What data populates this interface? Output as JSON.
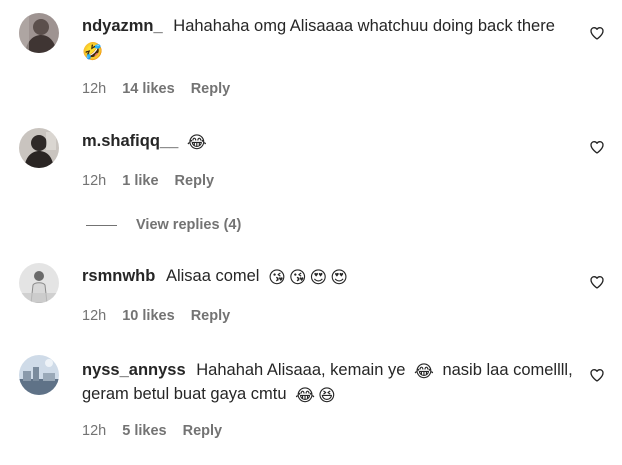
{
  "comments": [
    {
      "username": "ndyazmn_",
      "text": "Hahahaha omg Alisaaaa whatchuu doing back there",
      "emojis": [
        "🤣"
      ],
      "time": "12h",
      "likes": "14 likes",
      "reply": "Reply",
      "heart_icon": "heart-outline-icon"
    },
    {
      "username": "m.shafiqq__",
      "text": "",
      "emojis": [
        "😂"
      ],
      "time": "12h",
      "likes": "1 like",
      "reply": "Reply",
      "heart_icon": "heart-outline-icon"
    },
    {
      "username": "rsmnwhb",
      "text": "Alisaa comel",
      "emojis": [
        "😘",
        "😘",
        "😍",
        "😍"
      ],
      "time": "12h",
      "likes": "10 likes",
      "reply": "Reply",
      "heart_icon": "heart-outline-icon"
    },
    {
      "username": "nyss_annyss",
      "text_part1": "Hahahah Alisaaa, kemain ye",
      "text_part2": "nasib laa comellll,",
      "text_part3": "geram betul buat gaya cmtu",
      "emojis_mid": [
        "😂"
      ],
      "emojis_end": [
        "😂",
        "😆"
      ],
      "time": "12h",
      "likes": "5 likes",
      "reply": "Reply",
      "heart_icon": "heart-outline-icon"
    }
  ],
  "view_replies": {
    "label": "View replies (4)"
  },
  "colors": {
    "text": "#262626",
    "secondary": "#737373",
    "background": "#ffffff"
  }
}
